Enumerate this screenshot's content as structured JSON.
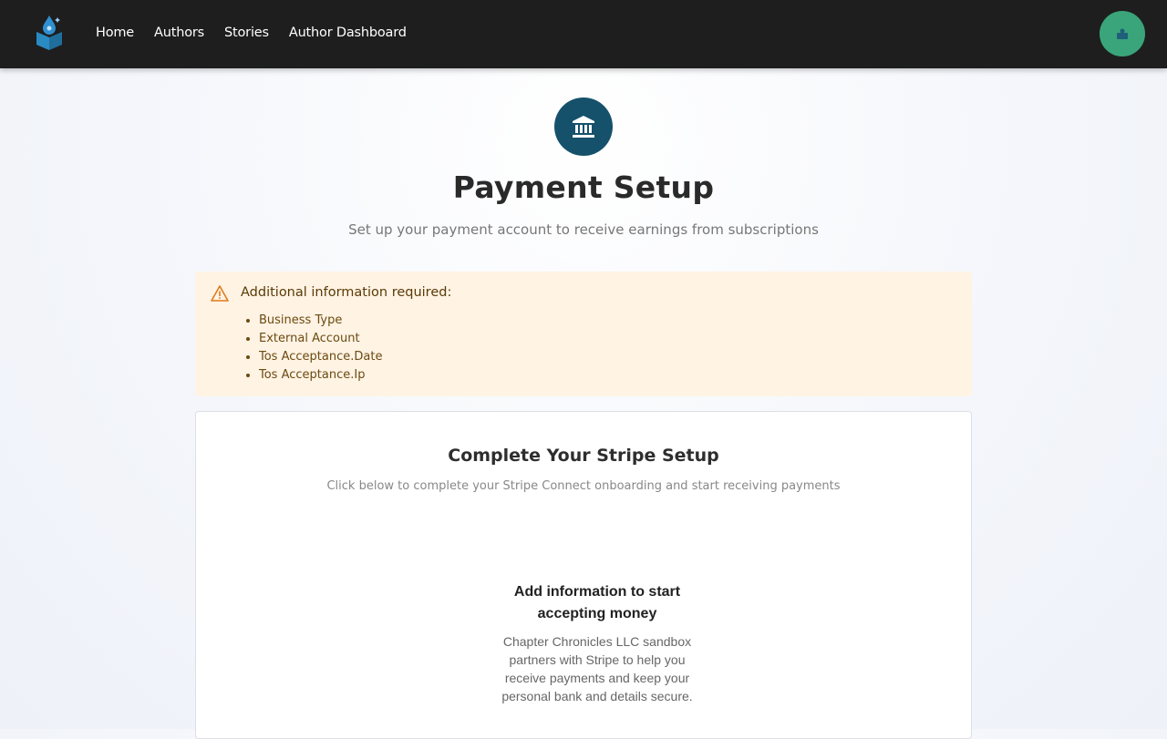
{
  "nav": {
    "links": [
      "Home",
      "Authors",
      "Stories",
      "Author Dashboard"
    ],
    "logo_icon": "book-drop-logo-icon",
    "avatar_icon": "user-avatar-icon"
  },
  "hero": {
    "icon": "bank-icon",
    "title": "Payment Setup",
    "subtitle": "Set up your payment account to receive earnings from subscriptions"
  },
  "alert": {
    "icon": "warning-triangle-icon",
    "title": "Additional information required:",
    "items": [
      "Business Type",
      "External Account",
      "Tos Acceptance.Date",
      "Tos Acceptance.Ip"
    ]
  },
  "card": {
    "title": "Complete Your Stripe Setup",
    "subtitle": "Click below to complete your Stripe Connect onboarding and start receiving payments",
    "embed_title": "Add information to start accepting money",
    "embed_text": "Chapter Chronicles LLC sandbox partners with Stripe to help you receive payments and keep your personal bank and details secure."
  },
  "colors": {
    "navbar": "#1e1e1e",
    "accent": "#15516b",
    "avatar": "#3aa57a",
    "alert_bg": "#fff3e4",
    "warning": "#e07b1a"
  }
}
